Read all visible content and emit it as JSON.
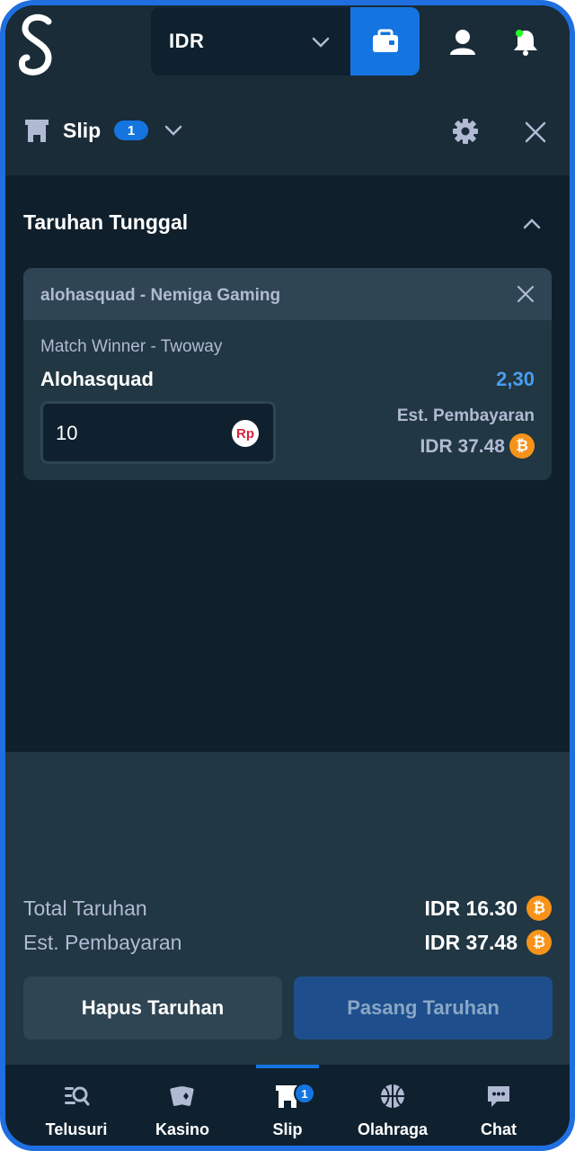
{
  "header": {
    "currency": "IDR",
    "logo_icon": "stake-s-logo",
    "wallet_icon": "wallet-icon",
    "user_icon": "user-icon",
    "notification_icon": "bell-icon"
  },
  "slip": {
    "title": "Slip",
    "count": "1"
  },
  "section": {
    "title": "Taruhan Tunggal"
  },
  "bet": {
    "event": "alohasquad - Nemiga Gaming",
    "market": "Match Winner - Twoway",
    "selection": "Alohasquad",
    "odds": "2,30",
    "stake": "10",
    "stake_currency_symbol": "Rp",
    "est_label": "Est. Pembayaran",
    "est_value": "IDR 37.48"
  },
  "summary": {
    "total_label": "Total Taruhan",
    "total_value": "IDR 16.30",
    "est_label": "Est. Pembayaran",
    "est_value": "IDR 37.48",
    "btc_symbol": "₿"
  },
  "actions": {
    "clear": "Hapus Taruhan",
    "place": "Pasang Taruhan"
  },
  "nav": {
    "items": [
      {
        "label": "Telusuri",
        "icon": "search-list-icon"
      },
      {
        "label": "Kasino",
        "icon": "cards-icon"
      },
      {
        "label": "Slip",
        "icon": "betslip-icon",
        "badge": "1",
        "active": true
      },
      {
        "label": "Olahraga",
        "icon": "basketball-icon"
      },
      {
        "label": "Chat",
        "icon": "chat-icon"
      }
    ]
  },
  "colors": {
    "accent": "#1475e1",
    "background": "#0f1f2c",
    "panel": "#213743",
    "odds": "#4a9df0",
    "btc": "#f7931a"
  }
}
